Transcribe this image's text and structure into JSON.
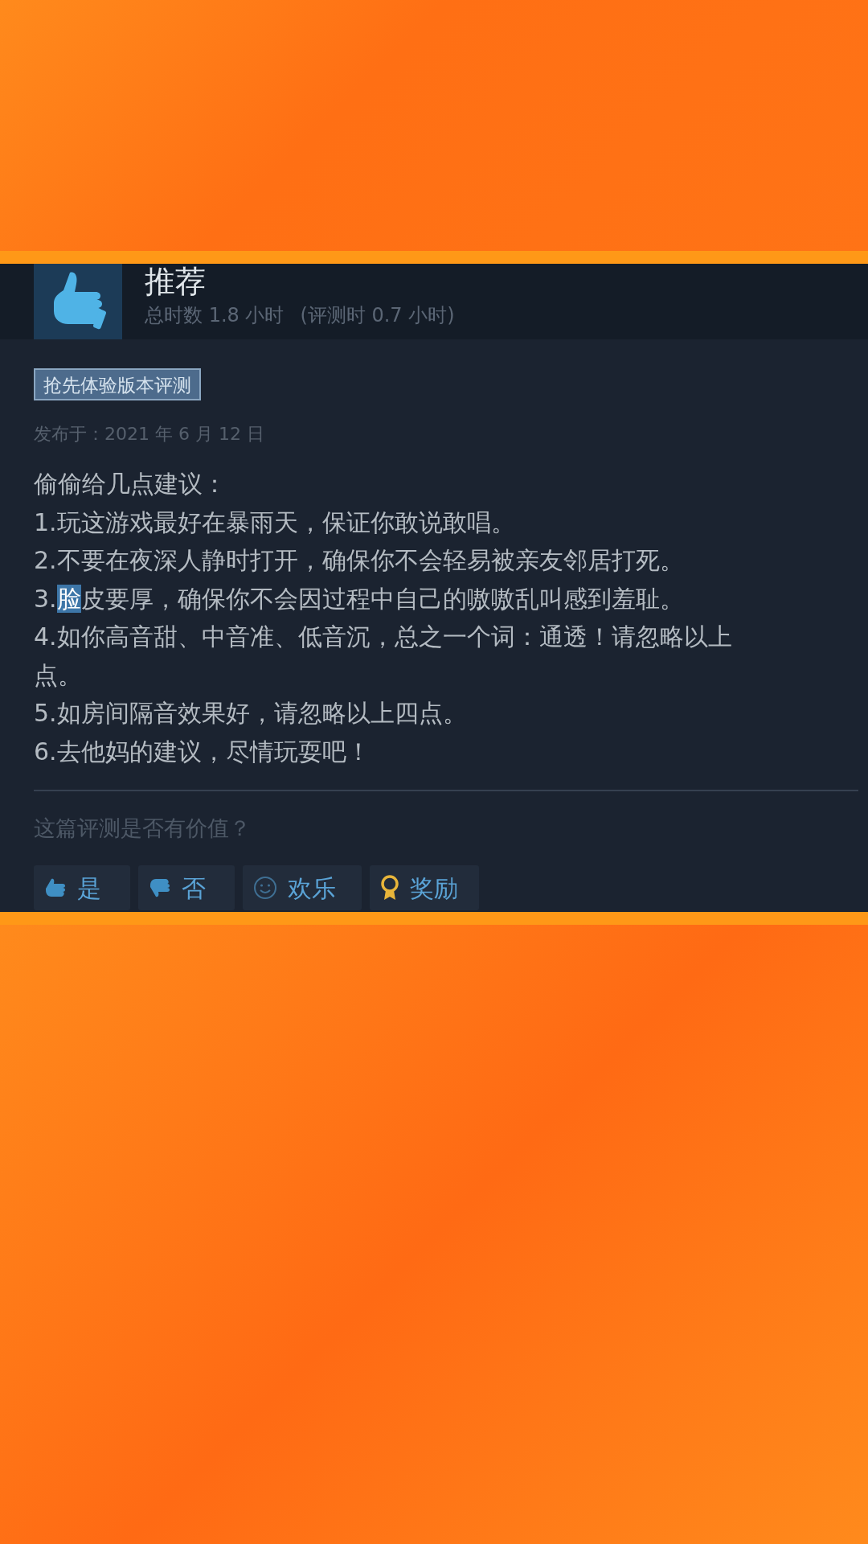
{
  "review": {
    "verdict": "推荐",
    "recommended": true,
    "hours": "总时数 1.8 小时",
    "review_hours": "(评测时 0.7 小时)",
    "tag": "抢先体验版本评测",
    "posted": "发布于：2021 年 6 月 12 日",
    "lines": [
      {
        "text_before": "偷偷给几点建议："
      },
      {
        "text_before": "1.玩这游戏最好在暴雨天，保证你敢说敢唱。"
      },
      {
        "text_before": "2.不要在夜深人静时打开，确保你不会轻易被亲友邻居打死。"
      },
      {
        "text_before": "3.",
        "selected_text": "脸",
        "text_after": "皮要厚，确保你不会因过程中自己的嗷嗷乱叫感到羞耻。"
      },
      {
        "text_before": "4.如你高音甜、中音准、低音沉，总之一个词：通透！请忽略以上"
      },
      {
        "text_before": "点。"
      },
      {
        "text_before": "5.如房间隔音效果好，请忽略以上四点。"
      },
      {
        "text_before": "6.去他妈的建议，尽情玩耍吧！"
      }
    ],
    "helpful_prompt": "这篇评测是否有价值？",
    "buttons": [
      {
        "kind": "yes",
        "label": "是"
      },
      {
        "kind": "no",
        "label": "否"
      },
      {
        "kind": "funny",
        "label": "欢乐"
      },
      {
        "kind": "award",
        "label": "奖励"
      }
    ]
  }
}
